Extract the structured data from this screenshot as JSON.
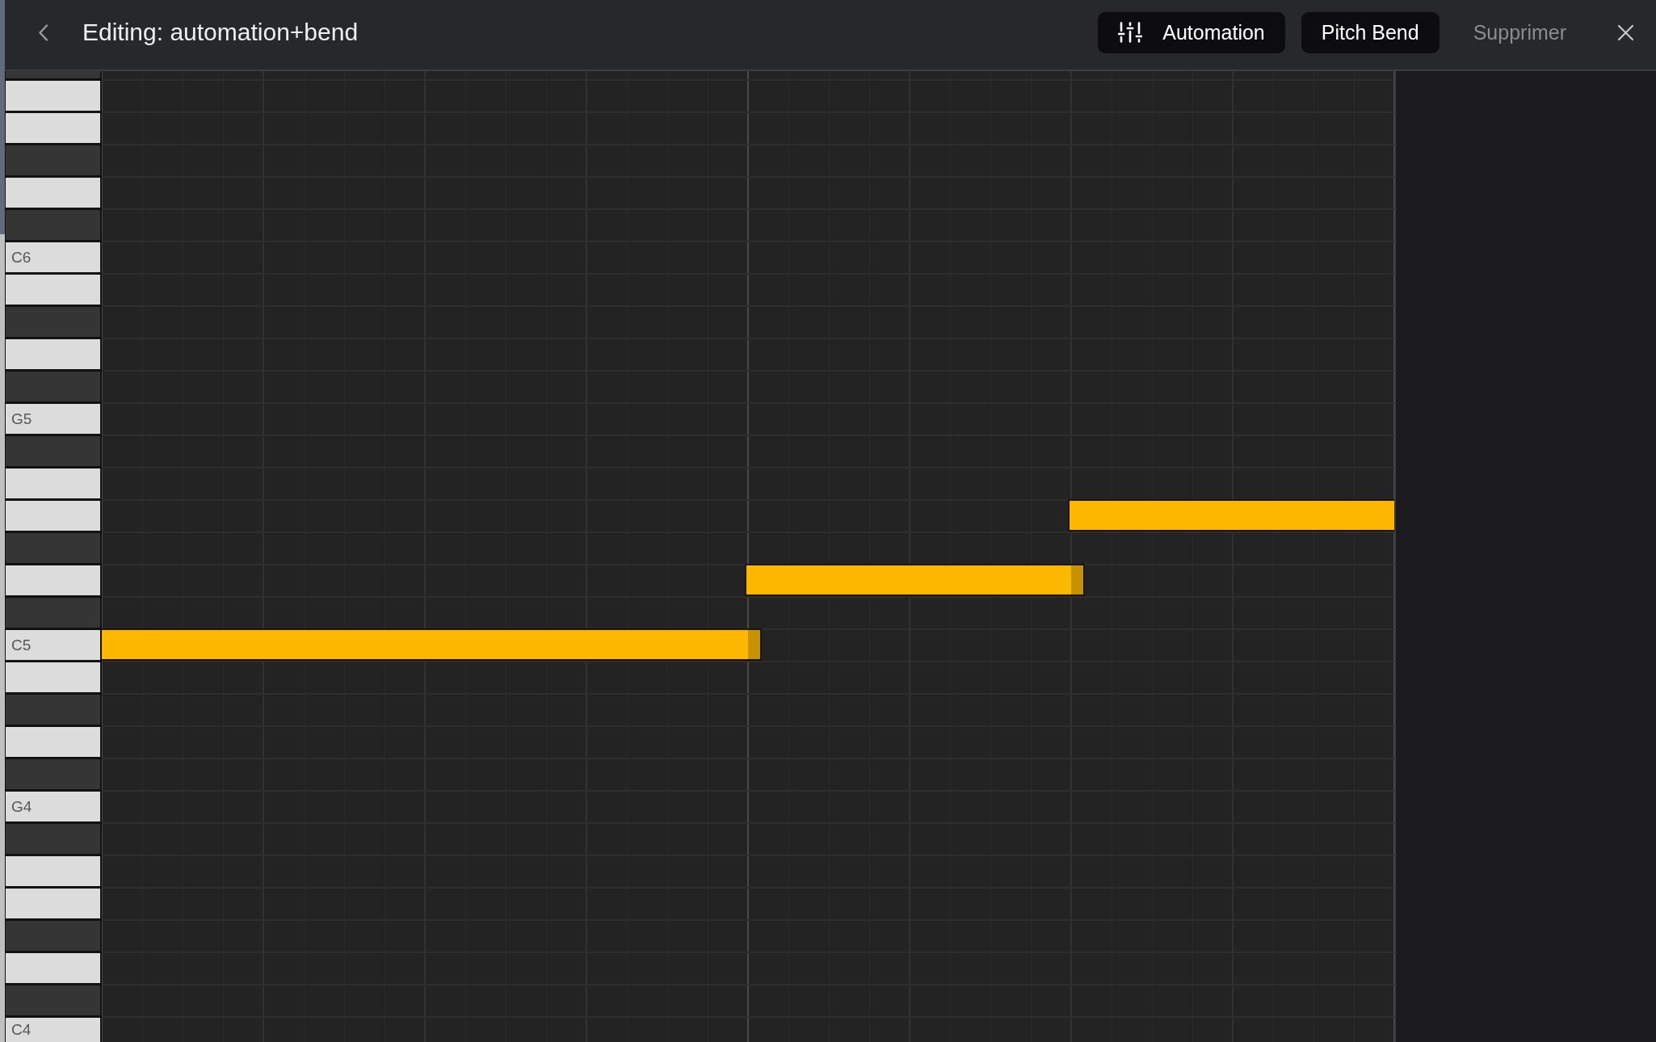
{
  "header": {
    "title": "Editing: automation+bend",
    "buttons": [
      {
        "label": "Automation",
        "kind": "icon"
      },
      {
        "label": "Pitch Bend",
        "kind": "filled"
      },
      {
        "label": "Supprimer",
        "kind": "text"
      }
    ]
  },
  "piano_roll": {
    "rows": [
      {
        "kind": "black"
      },
      {
        "kind": "white"
      },
      {
        "kind": "white"
      },
      {
        "kind": "black"
      },
      {
        "kind": "white"
      },
      {
        "kind": "black"
      },
      {
        "kind": "white",
        "label": "C6"
      },
      {
        "kind": "white"
      },
      {
        "kind": "black"
      },
      {
        "kind": "white"
      },
      {
        "kind": "black"
      },
      {
        "kind": "white",
        "label": "G5"
      },
      {
        "kind": "black"
      },
      {
        "kind": "white"
      },
      {
        "kind": "white",
        "beats": [
          false,
          false,
          false,
          false,
          false,
          false,
          true,
          true
        ]
      },
      {
        "kind": "black"
      },
      {
        "kind": "white",
        "beats": [
          false,
          false,
          false,
          false,
          true,
          true,
          false,
          false
        ]
      },
      {
        "kind": "black"
      },
      {
        "kind": "white",
        "label": "C5",
        "beats": [
          true,
          true,
          true,
          true,
          false,
          false,
          false,
          false
        ]
      },
      {
        "kind": "white"
      },
      {
        "kind": "black"
      },
      {
        "kind": "white"
      },
      {
        "kind": "black"
      },
      {
        "kind": "white",
        "label": "G4"
      },
      {
        "kind": "black"
      },
      {
        "kind": "white"
      },
      {
        "kind": "white"
      },
      {
        "kind": "black"
      },
      {
        "kind": "white"
      },
      {
        "kind": "black"
      },
      {
        "kind": "white",
        "label": "C4"
      }
    ]
  }
}
